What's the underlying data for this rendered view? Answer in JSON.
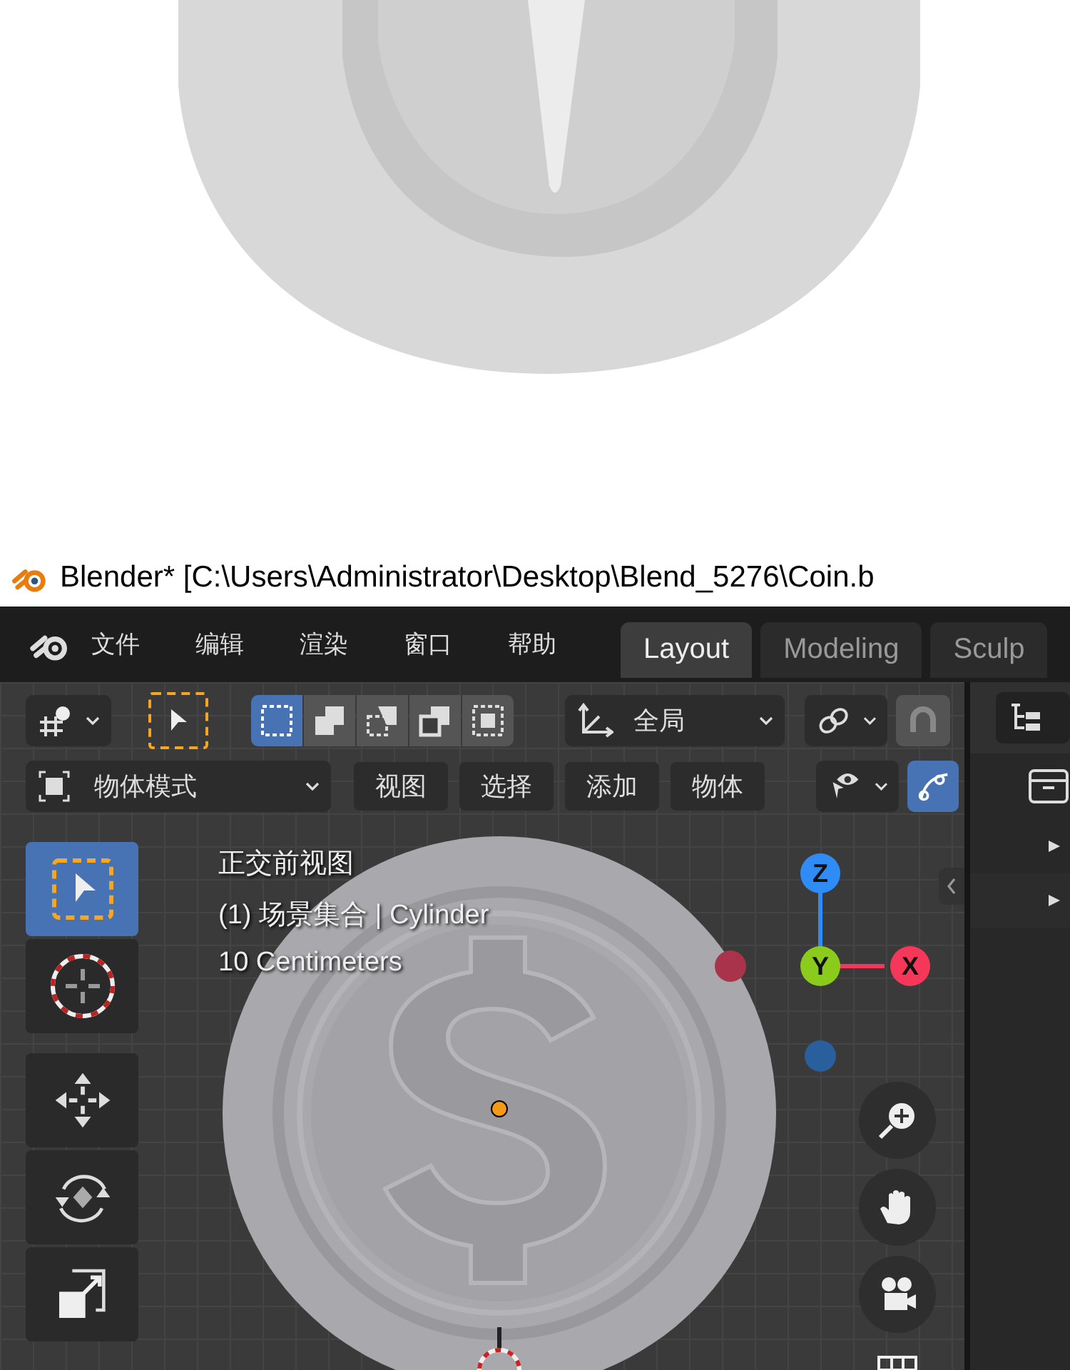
{
  "window": {
    "title": "Blender* [C:\\Users\\Administrator\\Desktop\\Blend_5276\\Coin.b"
  },
  "menu": [
    "文件",
    "编辑",
    "渲染",
    "窗口",
    "帮助"
  ],
  "workspaces": [
    {
      "label": "Layout",
      "selected": true
    },
    {
      "label": "Modeling",
      "selected": false
    },
    {
      "label": "Sculp",
      "selected": false
    }
  ],
  "header": {
    "select_modes": [
      {
        "selected": true
      },
      {
        "selected": false
      },
      {
        "selected": false
      },
      {
        "selected": false
      },
      {
        "selected": false
      }
    ],
    "orientation": "全局",
    "snap_on": false,
    "mode": "物体模式",
    "menus": [
      "视图",
      "选择",
      "添加",
      "物体"
    ],
    "gizmo_on": true
  },
  "tools": [
    {
      "kind": "select",
      "selected": true
    },
    {
      "kind": "cursor",
      "selected": false
    },
    {
      "kind": "move",
      "selected": false
    },
    {
      "kind": "rotate",
      "selected": false
    },
    {
      "kind": "scale",
      "selected": false
    }
  ],
  "overlay": [
    "正交前视图",
    "(1) 场景集合 | Cylinder",
    "10 Centimeters"
  ],
  "gizmo_axes": [
    {
      "label": "Z",
      "color": "#2f8cf5"
    },
    {
      "label": "Y",
      "color": "#8acb1c"
    },
    {
      "label": "X",
      "color": "#f5385a"
    }
  ]
}
